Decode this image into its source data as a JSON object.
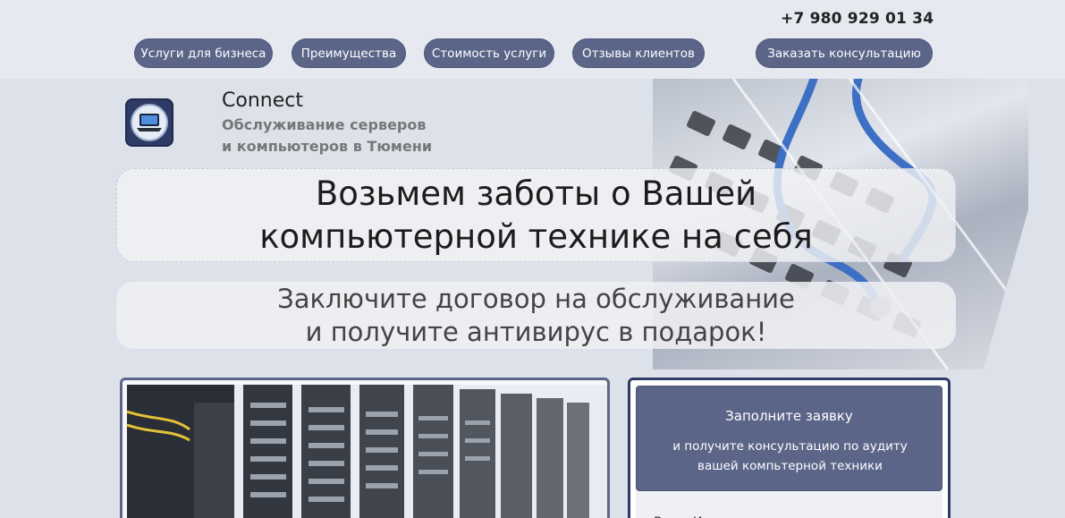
{
  "header": {
    "phone": "+7 980 929 01 34",
    "nav": [
      {
        "label": "Услуги для бизнеса"
      },
      {
        "label": "Преимущества"
      },
      {
        "label": "Стоимость услуги"
      },
      {
        "label": "Отзывы клиентов"
      }
    ],
    "cta_label": "Заказать консультацию"
  },
  "brand": {
    "name": "Connect",
    "tagline_line1": "Обслуживание серверов",
    "tagline_line2": "и компьютеров в Тюмени"
  },
  "hero": {
    "headline_line1": "Возьмем заботы о Вашей",
    "headline_line2": "компьютерной технике на себя",
    "offer_line1": "Заключите договор на обслуживание",
    "offer_line2": "и получите антивирус в подарок!"
  },
  "form": {
    "title": "Заполните заявку",
    "subtitle_line1": "и получите консультацию по аудиту",
    "subtitle_line2": "вашей компьтерной техники",
    "name_placeholder": "Ваше Имя"
  },
  "colors": {
    "accent": "#5b6588",
    "dark": "#2e3b66",
    "background": "#dde1ea"
  },
  "icons": {
    "logo": "laptop-logo-icon"
  }
}
